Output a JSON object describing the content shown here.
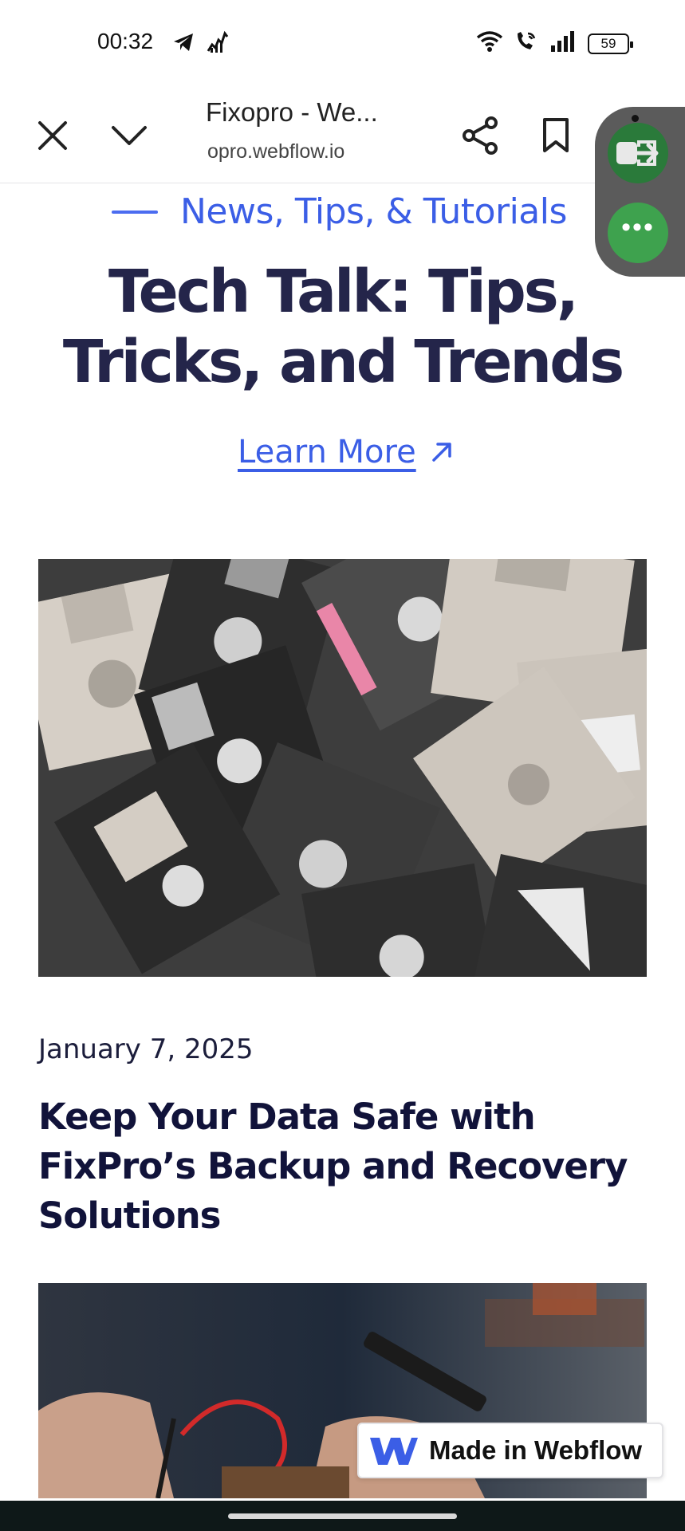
{
  "status_bar": {
    "time": "00:32",
    "battery": "59",
    "icons": [
      "telegram-icon",
      "signal-app-icon",
      "wifi-icon",
      "wifi-calling-icon",
      "cell-signal-icon",
      "battery-icon"
    ]
  },
  "browser": {
    "page_title": "Fixopro - We...",
    "url": "opro.webflow.io",
    "buttons": [
      "close-icon",
      "chevron-down-icon",
      "share-icon",
      "bookmark-icon"
    ]
  },
  "side_panel": {
    "colors": {
      "panel": "#5b5b5b",
      "button_dark": "#2a7a3a",
      "button_light": "#3ea24e"
    }
  },
  "hero": {
    "eyebrow": "News, Tips, & Tutorials",
    "title_bold": "Tech Talk:",
    "title_rest_line1": " Tips,",
    "title_line2": "Tricks, and Trends",
    "learn_more": "Learn More",
    "accent_color": "#3b5ee6"
  },
  "posts": [
    {
      "date": "January 7, 2025",
      "title": "Keep Your Data Safe with FixPro’s Backup and Recovery Solutions"
    }
  ],
  "badge": {
    "label": "Made in Webflow"
  }
}
